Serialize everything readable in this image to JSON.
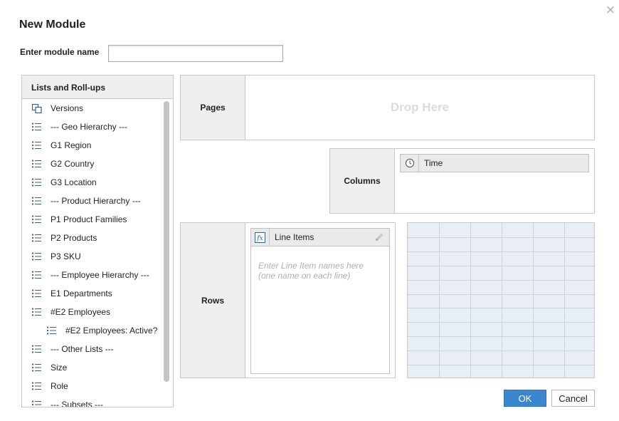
{
  "dialog": {
    "title": "New Module",
    "close_glyph": "×",
    "name_label": "Enter module name",
    "name_value": ""
  },
  "lists_panel": {
    "header": "Lists and Roll-ups",
    "items": [
      {
        "label": "Versions",
        "icon": "versions-icon"
      },
      {
        "label": "--- Geo Hierarchy ---",
        "icon": "list-icon"
      },
      {
        "label": "G1 Region",
        "icon": "list-icon"
      },
      {
        "label": "G2 Country",
        "icon": "list-icon"
      },
      {
        "label": "G3 Location",
        "icon": "list-icon"
      },
      {
        "label": "--- Product Hierarchy ---",
        "icon": "list-icon"
      },
      {
        "label": "P1 Product Families",
        "icon": "list-icon"
      },
      {
        "label": "P2 Products",
        "icon": "list-icon"
      },
      {
        "label": "P3 SKU",
        "icon": "list-icon"
      },
      {
        "label": "--- Employee Hierarchy ---",
        "icon": "list-icon"
      },
      {
        "label": "E1 Departments",
        "icon": "list-icon"
      },
      {
        "label": "#E2 Employees",
        "icon": "list-icon"
      },
      {
        "label": "#E2 Employees: Active?",
        "icon": "subset-icon",
        "sub": true
      },
      {
        "label": "--- Other Lists ---",
        "icon": "list-icon"
      },
      {
        "label": "Size",
        "icon": "list-icon"
      },
      {
        "label": "Role",
        "icon": "list-icon"
      },
      {
        "label": "--- Subsets ---",
        "icon": "list-icon"
      }
    ]
  },
  "pages": {
    "label": "Pages",
    "drop_text": "Drop Here"
  },
  "columns": {
    "label": "Columns",
    "items": [
      {
        "label": "Time",
        "icon": "clock-icon"
      }
    ]
  },
  "rows": {
    "label": "Rows",
    "line_items": {
      "label": "Line Items",
      "icon": "fx-icon",
      "placeholder": "Enter Line Item names here\n(one name on each line)",
      "value": ""
    }
  },
  "buttons": {
    "ok": "OK",
    "cancel": "Cancel"
  },
  "colors": {
    "accent": "#3a86cf",
    "icon": "#3a5f8a",
    "panel_bg": "#efefef",
    "grid_bg": "#e9eef6"
  }
}
